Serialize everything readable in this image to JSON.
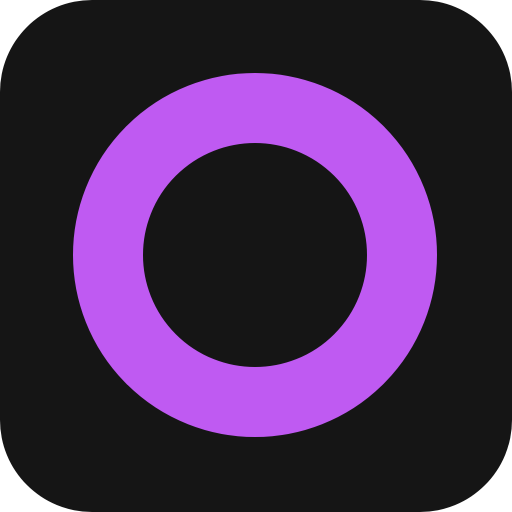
{
  "app_icon": {
    "icon": "ring-icon",
    "colors": {
      "tile_background": "#151515",
      "ring": "#BF5AF2",
      "page_background": "#ffffff"
    }
  }
}
